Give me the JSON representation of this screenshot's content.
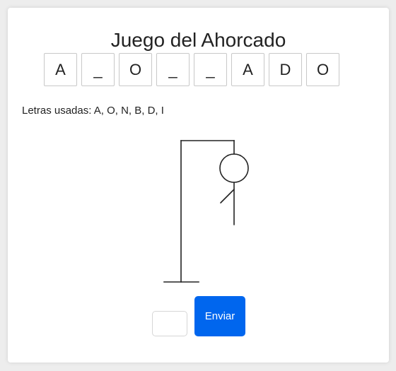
{
  "game": {
    "title": "Juego del Ahorcado",
    "word_slots": [
      "A",
      "_",
      "O",
      "_",
      "_",
      "A",
      "D",
      "O"
    ],
    "used_letters_label": "Letras usadas: A, O, N, B, D, I",
    "wrong_guesses": 3
  },
  "form": {
    "input_value": "",
    "input_placeholder": "",
    "submit_label": "Enviar"
  },
  "colors": {
    "button_bg": "#0066ee",
    "drawing_stroke": "#222222"
  },
  "icons": {
    "hangman": "hangman-drawing"
  }
}
